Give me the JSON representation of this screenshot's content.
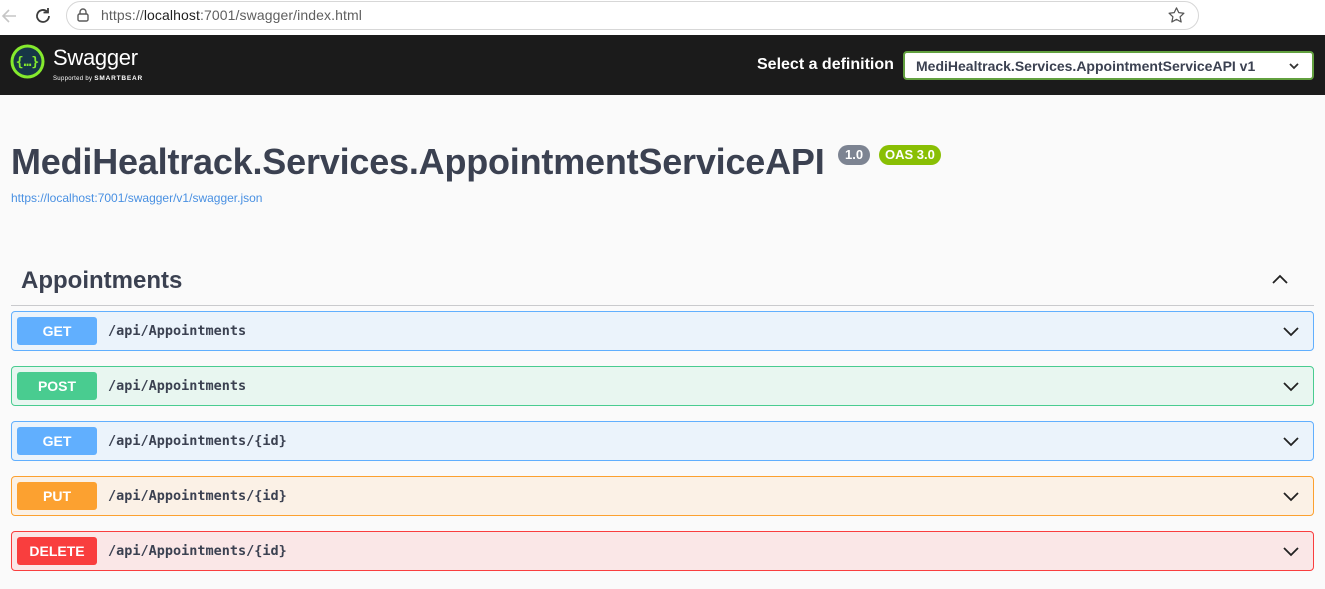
{
  "browser": {
    "url_prefix": "https://",
    "url_host": "localhost",
    "url_rest": ":7001/swagger/index.html"
  },
  "topbar": {
    "logo_name": "Swagger",
    "logo_sub_prefix": "Supported by",
    "logo_sub_brand": "SMARTBEAR",
    "definition_label": "Select a definition",
    "definition_value": "MediHealtrack.Services.AppointmentServiceAPI v1"
  },
  "info": {
    "title": "MediHealtrack.Services.AppointmentServiceAPI",
    "version": "1.0",
    "oas": "OAS 3.0",
    "spec_url": "https://localhost:7001/swagger/v1/swagger.json"
  },
  "tag": {
    "name": "Appointments"
  },
  "operations": [
    {
      "method": "GET",
      "path": "/api/Appointments"
    },
    {
      "method": "POST",
      "path": "/api/Appointments"
    },
    {
      "method": "GET",
      "path": "/api/Appointments/{id}"
    },
    {
      "method": "PUT",
      "path": "/api/Appointments/{id}"
    },
    {
      "method": "DELETE",
      "path": "/api/Appointments/{id}"
    }
  ],
  "colors": {
    "get": "#61affe",
    "post": "#49cc90",
    "put": "#fca130",
    "delete": "#f93e3e",
    "topbar": "#1b1b1b",
    "oas_badge": "#89bf04"
  }
}
